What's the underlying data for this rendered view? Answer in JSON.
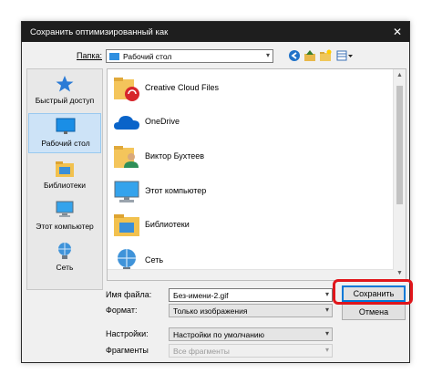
{
  "dialog": {
    "title": "Сохранить оптимизированный как",
    "close_glyph": "✕"
  },
  "toolbar": {
    "folder_label": "Папка:",
    "folder_value": "Рабочий стол",
    "icons": [
      "back-icon",
      "up-folder-icon",
      "new-folder-icon",
      "view-menu-icon"
    ]
  },
  "places": [
    {
      "label": "Быстрый доступ",
      "icon": "star-icon",
      "selected": false
    },
    {
      "label": "Рабочий стол",
      "icon": "desktop-icon",
      "selected": true
    },
    {
      "label": "Библиотеки",
      "icon": "libraries-icon",
      "selected": false
    },
    {
      "label": "Этот компьютер",
      "icon": "computer-icon",
      "selected": false
    },
    {
      "label": "Сеть",
      "icon": "network-icon",
      "selected": false
    }
  ],
  "files": [
    {
      "name": "Creative Cloud Files",
      "icon": "creative-cloud-folder-icon"
    },
    {
      "name": "OneDrive",
      "icon": "onedrive-cloud-icon"
    },
    {
      "name": "Виктор Бухтеев",
      "icon": "user-folder-icon"
    },
    {
      "name": "Этот компьютер",
      "icon": "computer-icon"
    },
    {
      "name": "Библиотеки",
      "icon": "libraries-icon"
    },
    {
      "name": "Сеть",
      "icon": "network-icon"
    }
  ],
  "form": {
    "filename_label": "Имя файла:",
    "filename_value": "Без-имени-2.gif",
    "format_label": "Формат:",
    "format_value": "Только изображения",
    "settings_label": "Настройки:",
    "settings_value": "Настройки по умолчанию",
    "fragments_label": "Фрагменты",
    "fragments_value": "Все фрагменты"
  },
  "buttons": {
    "save": "Сохранить",
    "cancel": "Отмена"
  },
  "colors": {
    "titlebar": "#1e1e1e",
    "accent": "#0078d7",
    "highlight": "#e0161b"
  }
}
